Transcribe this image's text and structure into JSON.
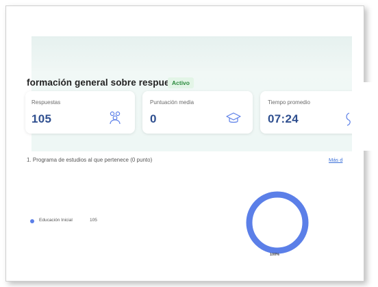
{
  "summary": {
    "title": "formación general sobre respuestas",
    "status_badge": "Activo"
  },
  "cards": [
    {
      "label": "Respuestas",
      "value": "105",
      "icon": "users-icon"
    },
    {
      "label": "Puntuación media",
      "value": "0",
      "icon": "graduation-cap-icon"
    },
    {
      "label": "Tiempo promedio",
      "value": "07:24",
      "icon": "timer-icon"
    }
  ],
  "question": {
    "title": "1. Programa de estudios al que pertenece (0 punto)",
    "more_link": "Más d"
  },
  "chart_data": {
    "type": "pie",
    "categories": [
      "Educación Inicial"
    ],
    "values": [
      105
    ],
    "percent_label": "100%",
    "colors": [
      "#5b7fe8"
    ]
  }
}
